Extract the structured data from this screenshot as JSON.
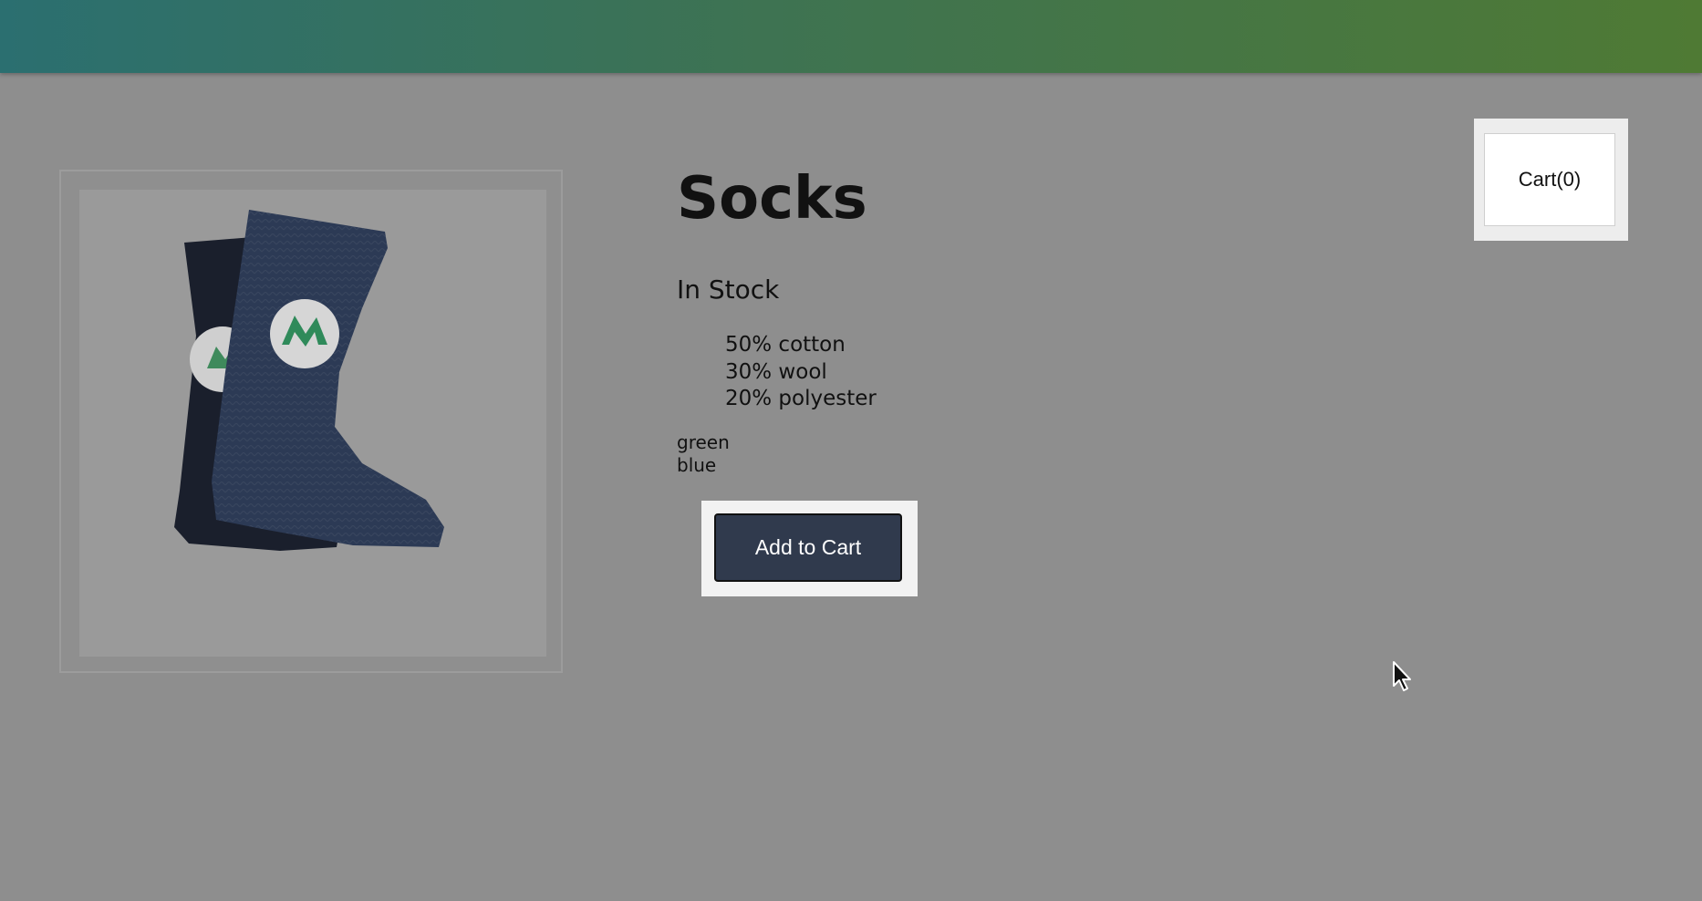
{
  "nav": {
    "gradient": [
      "#2b6f70",
      "#3e7352",
      "#4f7a34"
    ]
  },
  "product": {
    "image_alt": "socks-image",
    "title": "Socks",
    "stock_status": "In Stock",
    "details": [
      "50% cotton",
      "30% wool",
      "20% polyester"
    ],
    "variants": [
      "green",
      "blue"
    ],
    "add_to_cart_label": "Add to Cart"
  },
  "cart": {
    "label": "Cart(0)"
  },
  "colors": {
    "page_background": "#8e8e8e",
    "button_background": "#303a4d",
    "button_text": "#ffffff"
  }
}
